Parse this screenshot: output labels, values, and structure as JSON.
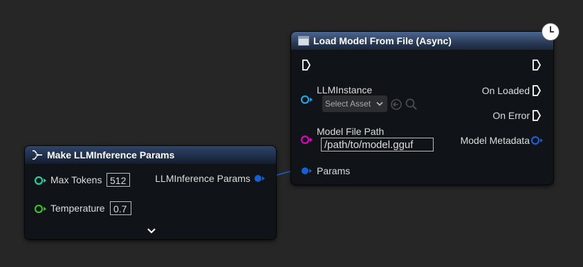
{
  "load_node": {
    "title": "Load Model From File (Async)",
    "llm_instance_label": "LLMInstance",
    "select_asset": "Select Asset",
    "model_file_path_label": "Model File Path",
    "model_file_path_value": "/path/to/model.gguf",
    "params_label": "Params",
    "on_loaded_label": "On Loaded",
    "on_error_label": "On Error",
    "model_metadata_label": "Model Metadata"
  },
  "make_node": {
    "title": "Make LLMInference Params",
    "max_tokens_label": "Max Tokens",
    "max_tokens_value": "512",
    "temperature_label": "Temperature",
    "temperature_value": "0.7",
    "output_label": "LLMInference Params"
  },
  "colors": {
    "struct_pin": "#1560d8",
    "object_pin": "#1aa6e0",
    "string_pin": "#e000c0",
    "int_pin": "#1ed2a0",
    "float_pin": "#39c21e",
    "header_blue": "#344a6c"
  },
  "icons": [
    "clock-icon",
    "function-icon",
    "exec-icon",
    "use-asset-icon",
    "browse-search-icon",
    "chevron-down-icon"
  ]
}
